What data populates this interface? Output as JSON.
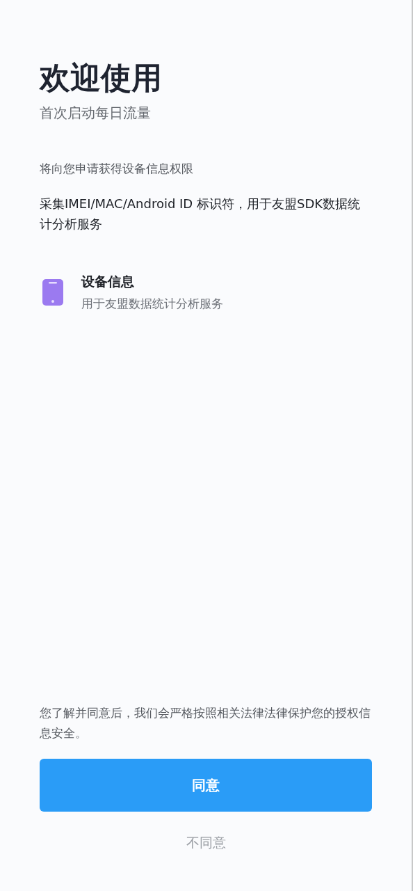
{
  "title": "欢迎使用",
  "subtitle": "首次启动每日流量",
  "request": "将向您申请获得设备信息权限",
  "description": "采集IMEI/MAC/Android ID 标识符，用于友盟SDK数据统计分析服务",
  "permissions": [
    {
      "name": "设备信息",
      "detail": "用于友盟数据统计分析服务"
    }
  ],
  "notice": "您了解并同意后，我们会严格按照相关法律法律保护您的授权信息安全。",
  "buttons": {
    "agree": "同意",
    "disagree": "不同意"
  }
}
